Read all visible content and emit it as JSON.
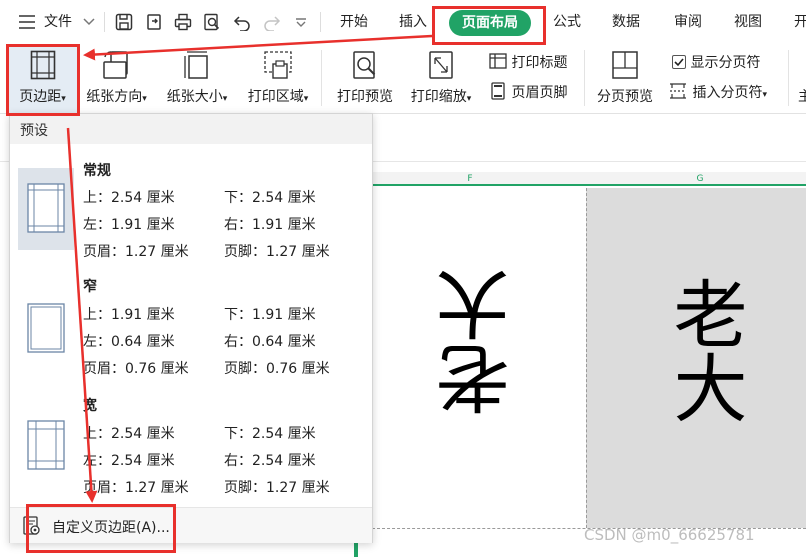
{
  "menubar": {
    "file_label": "文件",
    "tabs": [
      "开始",
      "插入",
      "页面布局",
      "公式",
      "数据",
      "审阅",
      "视图"
    ],
    "active_tab": "页面布局"
  },
  "ribbon": {
    "margins_label": "页边距",
    "orientation_label": "纸张方向",
    "size_label": "纸张大小",
    "print_area_label": "打印区域",
    "print_preview_label": "打印预览",
    "print_scale_label": "打印缩放",
    "print_titles_label": "打印标题",
    "header_footer_label": "页眉页脚",
    "page_break_preview_label": "分页预览",
    "show_page_breaks_label": "显示分页符",
    "show_page_breaks_checked": true,
    "insert_page_break_label": "插入分页符",
    "truncated_next_label": "主",
    "truncated_tab": "开"
  },
  "sheet": {
    "column_f": "F",
    "column_g": "G",
    "page1_text": "老大",
    "page2_text": "老大"
  },
  "dropdown": {
    "header": "预设",
    "presets": [
      {
        "name": "常规",
        "top": "上：2.54 厘米",
        "bottom": "下：2.54 厘米",
        "left": "左：1.91 厘米",
        "right": "右：1.91 厘米",
        "header": "页眉：1.27 厘米",
        "footer": "页脚：1.27 厘米"
      },
      {
        "name": "窄",
        "top": "上：1.91 厘米",
        "bottom": "下：1.91 厘米",
        "left": "左：0.64 厘米",
        "right": "右：0.64 厘米",
        "header": "页眉：0.76 厘米",
        "footer": "页脚：0.76 厘米"
      },
      {
        "name": "宽",
        "top": "上：2.54 厘米",
        "bottom": "下：2.54 厘米",
        "left": "左：2.54 厘米",
        "right": "右：2.54 厘米",
        "header": "页眉：1.27 厘米",
        "footer": "页脚：1.27 厘米"
      }
    ],
    "custom_label": "自定义页边距(A)..."
  },
  "watermark": "CSDN @m0_66625781",
  "colors": {
    "accent": "#21a366",
    "annotation": "#e8302c"
  }
}
